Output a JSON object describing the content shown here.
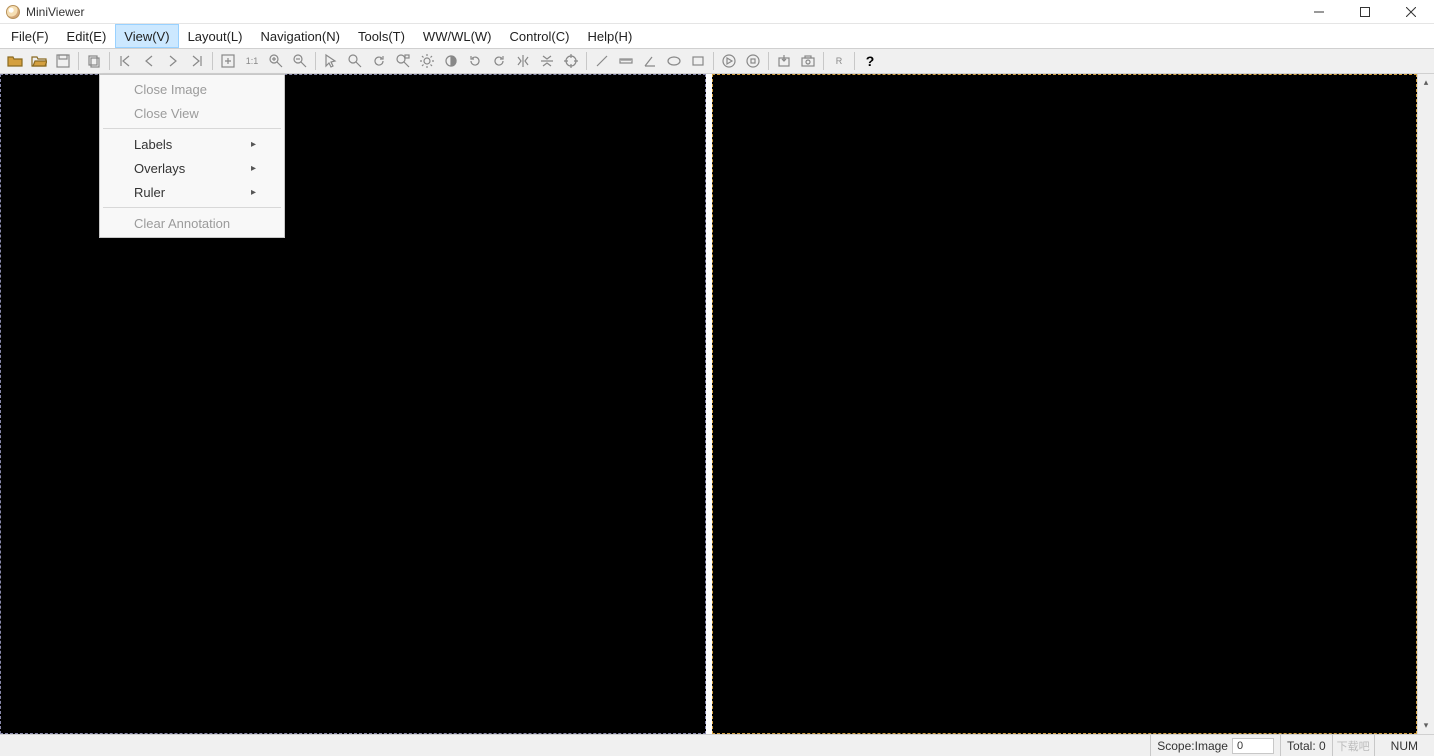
{
  "title": "MiniViewer",
  "menus": {
    "file": "File(F)",
    "edit": "Edit(E)",
    "view": "View(V)",
    "layout": "Layout(L)",
    "navigation": "Navigation(N)",
    "tools": "Tools(T)",
    "wwwl": "WW/WL(W)",
    "control": "Control(C)",
    "help": "Help(H)"
  },
  "view_menu": {
    "close_image": "Close Image",
    "close_view": "Close View",
    "labels": "Labels",
    "overlays": "Overlays",
    "ruler": "Ruler",
    "clear_annotation": "Clear Annotation"
  },
  "toolbar_labels": {
    "one_to_one": "1:1",
    "r": "R",
    "help": "?"
  },
  "status": {
    "scope_label": "Scope:Image",
    "scope_value": "0",
    "total_label": "Total: 0",
    "num": "NUM"
  },
  "watermark": "下载吧"
}
